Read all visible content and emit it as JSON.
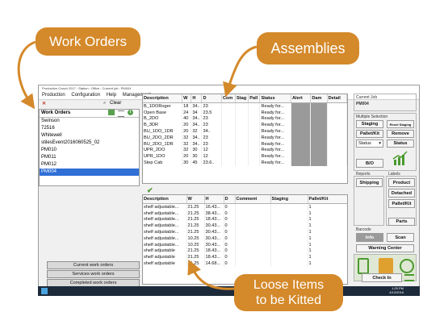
{
  "callouts": {
    "work_orders": "Work Orders",
    "assemblies": "Assemblies",
    "loose_items_line1": "Loose Items",
    "loose_items_line2": "to be Kitted"
  },
  "window": {
    "title": "Production Coach 2017 : Station : Office : Current job : PM004",
    "menu": [
      "Production",
      "Configuration",
      "Help",
      "Management"
    ]
  },
  "left": {
    "clear_label": "Clear",
    "list_header": "Work Orders",
    "items": [
      "Swinson",
      "72516",
      "Whitewell",
      "stilesEvent2016060525_02",
      "PM010",
      "PM011",
      "PM012",
      "PM004"
    ],
    "selected": "PM004",
    "buttons": [
      "Current work orders",
      "Services work orders",
      "Completed work orders"
    ]
  },
  "assemblies": {
    "columns": [
      "Description",
      "W",
      "H",
      "D",
      "Com",
      "Stag",
      "Pall",
      "Status",
      "Alert",
      "Dam",
      "Detail"
    ],
    "rows": [
      [
        "B_1DORoger",
        "18",
        "34..",
        "23",
        "",
        "",
        "",
        "Ready for..."
      ],
      [
        "Open Base",
        "24",
        "34",
        "23.5",
        "",
        "",
        "",
        "Ready for..."
      ],
      [
        "B_2DO",
        "40",
        "34..",
        "23",
        "",
        "",
        "",
        "Ready for..."
      ],
      [
        "B_3DR",
        "20",
        "34..",
        "23",
        "",
        "",
        "",
        "Ready for..."
      ],
      [
        "BU_1DO_1DR",
        "20",
        "32",
        "34..",
        "",
        "",
        "",
        "Ready for..."
      ],
      [
        "BU_2DO_2DR",
        "32",
        "34..",
        "23",
        "",
        "",
        "",
        "Ready for..."
      ],
      [
        "BU_2DO_1DR",
        "32",
        "34..",
        "23",
        "",
        "",
        "",
        "Ready for..."
      ],
      [
        "UPR_2DO",
        "32",
        "30",
        "12",
        "",
        "",
        "",
        "Ready for..."
      ],
      [
        "UPR_1DO",
        "20",
        "30",
        "12",
        "",
        "",
        "",
        "Ready for..."
      ],
      [
        "Step Cab",
        "30",
        "45",
        "23.6..",
        "",
        "",
        "",
        "Ready for..."
      ]
    ]
  },
  "loose_items": {
    "columns": [
      "Description",
      "W",
      "H",
      "D",
      "Comment",
      "Staging",
      "Pallet/Kit"
    ],
    "rows": [
      [
        "shelf adjustable...",
        "21.25",
        "16.43...",
        "0",
        "",
        "",
        "1"
      ],
      [
        "shelf adjustable...",
        "21.25",
        "38.43...",
        "0",
        "",
        "",
        "1"
      ],
      [
        "shelf adjustable...",
        "21.25",
        "18.43...",
        "0",
        "",
        "",
        "1"
      ],
      [
        "shelf adjustable...",
        "21.25",
        "30.43...",
        "0",
        "",
        "",
        "1"
      ],
      [
        "shelf adjustable...",
        "21.25",
        "30.43...",
        "0",
        "",
        "",
        "1"
      ],
      [
        "shelf adjustable...",
        "10.25",
        "30.43...",
        "0",
        "",
        "",
        "1"
      ],
      [
        "shelf adjustable...",
        "10.25",
        "30.43...",
        "0",
        "",
        "",
        "1"
      ],
      [
        "shelf adjustable",
        "21.25",
        "18.43...",
        "0",
        "",
        "",
        "1"
      ],
      [
        "shelf adjustable",
        "21.25",
        "18.43...",
        "0",
        "",
        "",
        "1"
      ],
      [
        "shelf adjustable",
        "21.25",
        "14.68...",
        "0",
        "",
        "",
        "1"
      ]
    ]
  },
  "right": {
    "current_job_label": "Current Job",
    "current_job_value": "PM004",
    "multiple_selection_label": "Multiple Selection",
    "staging": "Staging",
    "reset_staging": "Reset Staging",
    "pallet_kit": "Pallet/Kit",
    "remove": "Remove",
    "status_select": "Status",
    "status_btn": "Status",
    "bo": "B/O",
    "reports_label": "Reports",
    "labels_label": "Labels",
    "shipping": "Shipping",
    "product": "Product",
    "detached": "Detached",
    "pallet_kit2": "Pallet/Kit",
    "parts": "Parts",
    "barcode_label": "Barcode",
    "info": "Info",
    "scan": "Scan",
    "warning_center": "Warning Center",
    "check_in": "Check In"
  },
  "taskbar": {
    "time": "1:25 PM",
    "date": "4/12/2016"
  },
  "colors": {
    "accent": "#d4892a",
    "selection": "#2f6fd6",
    "green": "#4a9a2e"
  }
}
